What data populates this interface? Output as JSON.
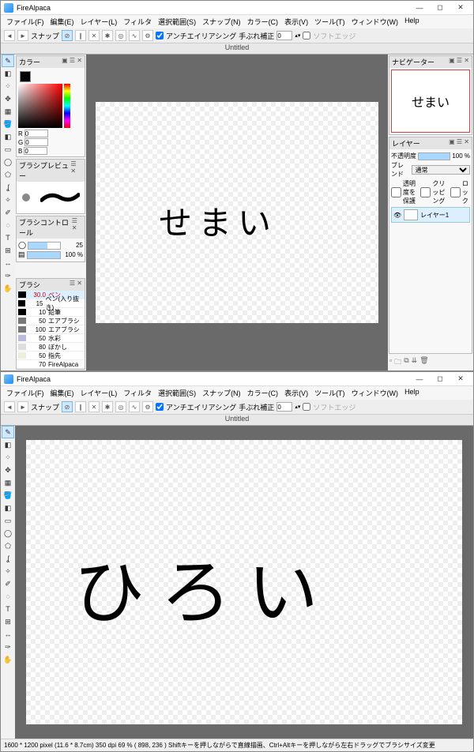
{
  "app_name": "FireAlpaca",
  "win_controls": {
    "min": "—",
    "max": "◻",
    "close": "✕"
  },
  "menu": [
    "ファイル(F)",
    "編集(E)",
    "レイヤー(L)",
    "フィルタ",
    "選択範囲(S)",
    "スナップ(N)",
    "カラー(C)",
    "表示(V)",
    "ツール(T)",
    "ウィンドウ(W)",
    "Help"
  ],
  "toolbar": {
    "snap_label": "スナップ",
    "aa_label": "アンチエイリアシング",
    "shake_label": "手ぶれ補正",
    "shake_value": "0",
    "softedge_label": "ソフトエッジ"
  },
  "tab_title": "Untitled",
  "panels": {
    "color": "カラー",
    "brush_preview": "ブラシプレビュー",
    "brush_control": "ブラシコントロール",
    "brush": "ブラシ",
    "navigator": "ナビゲーター",
    "layer": "レイヤー"
  },
  "color": {
    "r_label": "R",
    "g_label": "G",
    "b_label": "B",
    "r": "0",
    "g": "0",
    "b": "0"
  },
  "brush_control": {
    "size": "25",
    "opacity": "100 %"
  },
  "brushes": [
    {
      "size": "30.0",
      "name": "ペン",
      "sel": true,
      "sw": "#000"
    },
    {
      "size": "15",
      "name": "ペン(入り抜き)",
      "sw": "#000"
    },
    {
      "size": "10",
      "name": "鉛筆",
      "sw": "#000"
    },
    {
      "size": "50",
      "name": "エアブラシ",
      "sw": "#777"
    },
    {
      "size": "100",
      "name": "エアブラシ",
      "sw": "#777"
    },
    {
      "size": "50",
      "name": "水彩",
      "sw": "#bbd"
    },
    {
      "size": "80",
      "name": "ぼかし",
      "sw": "#ddd"
    },
    {
      "size": "50",
      "name": "指先",
      "sw": "#eed"
    },
    {
      "size": "70",
      "name": "FireAlpaca",
      "sw": "#fff"
    }
  ],
  "layer_panel": {
    "opacity_label": "不透明度",
    "opacity": "100 %",
    "blend_label": "ブレンド",
    "blend_value": "通常",
    "protect_label": "透明度を保護",
    "clip_label": "クリッピング",
    "lock_label": "ロック",
    "layer1": "レイヤー1"
  },
  "canvas1_text": "せまい",
  "canvas2_text": "ひろい",
  "status": "1600 * 1200 pixel   (11.6 * 8.7cm)   350 dpi   69 %    ( 898, 236 )   Shiftキーを押しながらで直線描画、Ctrl+Altキーを押しながら左右ドラッグでブラシサイズ変更"
}
